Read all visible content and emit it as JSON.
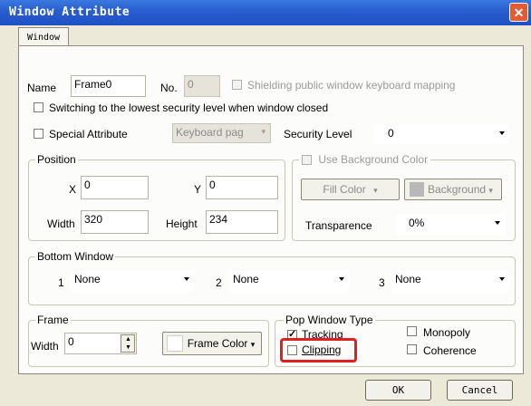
{
  "window": {
    "title": "Window Attribute",
    "close_glyph": "✕"
  },
  "tab": {
    "label": "Window"
  },
  "name_row": {
    "name_label": "Name",
    "name_value": "Frame0",
    "no_label": "No.",
    "no_value": "0",
    "shield_label": "Shielding public window keyboard mapping"
  },
  "switch_row": {
    "label": "Switching to the lowest security level when window closed"
  },
  "special_row": {
    "label": "Special Attribute",
    "keyboard_placeholder": "Keyboard pag",
    "security_label": "Security Level",
    "security_value": "0"
  },
  "position": {
    "legend": "Position",
    "x_label": "X",
    "x_value": "0",
    "y_label": "Y",
    "y_value": "0",
    "width_label": "Width",
    "width_value": "320",
    "height_label": "Height",
    "height_value": "234"
  },
  "background": {
    "use_label": "Use Background Color",
    "fill_label": "Fill Color",
    "background_label": "Background",
    "transparence_label": "Transparence",
    "transparence_value": "0%"
  },
  "bottom_window": {
    "legend": "Bottom Window",
    "items": [
      {
        "num": "1",
        "value": "None"
      },
      {
        "num": "2",
        "value": "None"
      },
      {
        "num": "3",
        "value": "None"
      }
    ]
  },
  "frame": {
    "legend": "Frame",
    "width_label": "Width",
    "width_value": "0",
    "frame_color_label": "Frame Color"
  },
  "pop": {
    "legend": "Pop Window Type",
    "tracking": "Tracking",
    "clipping": "Clipping",
    "monopoly": "Monopoly",
    "coherence": "Coherence"
  },
  "footer": {
    "ok": "OK",
    "cancel": "Cancel"
  },
  "colors": {
    "title_bar": "#2a5fd0",
    "highlight": "#e02020",
    "close": "#e35a33"
  }
}
